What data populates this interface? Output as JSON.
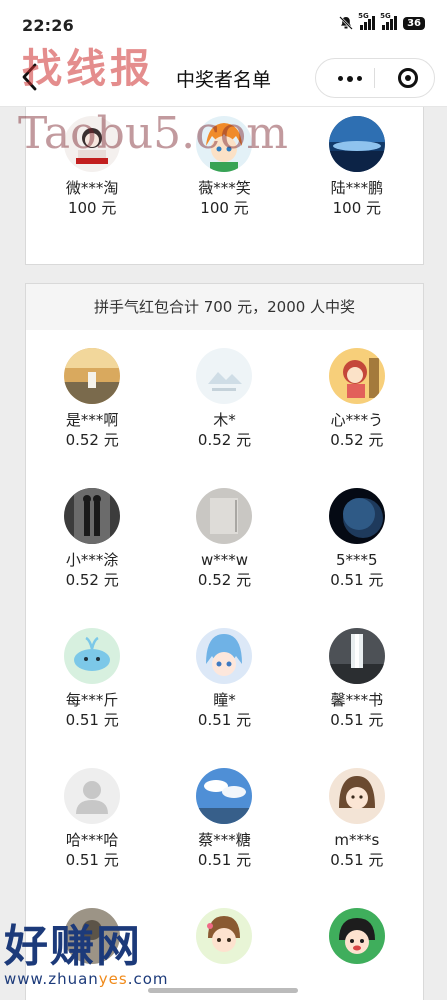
{
  "status_bar": {
    "time": "22:26",
    "network_1": "5G",
    "network_2": "5G",
    "battery": "36"
  },
  "nav": {
    "title": "中奖者名单"
  },
  "watermarks": {
    "top": "找线报",
    "mid": "Taobu5.com",
    "bottom_big": "好赚网",
    "bottom_small_a": "www.zhuan",
    "bottom_small_b": "yes",
    "bottom_small_c": ".com"
  },
  "prize_group_1": {
    "winners": [
      {
        "name": "微***淘",
        "amount": "100 元"
      },
      {
        "name": "薇***笑",
        "amount": "100 元"
      },
      {
        "name": "陆***鹏",
        "amount": "100 元"
      }
    ]
  },
  "prize_group_2": {
    "title": "拼手气红包合计 700 元，2000 人中奖",
    "winners": [
      {
        "name": "是***啊",
        "amount": "0.52 元"
      },
      {
        "name": "木*",
        "amount": "0.52 元"
      },
      {
        "name": "心***う",
        "amount": "0.52 元"
      },
      {
        "name": "小***涂",
        "amount": "0.52 元"
      },
      {
        "name": "w***w",
        "amount": "0.52 元"
      },
      {
        "name": "5***5",
        "amount": "0.51 元"
      },
      {
        "name": "每***斤",
        "amount": "0.51 元"
      },
      {
        "name": "瞳*",
        "amount": "0.51 元"
      },
      {
        "name": "馨***书",
        "amount": "0.51 元"
      },
      {
        "name": "哈***哈",
        "amount": "0.51 元"
      },
      {
        "name": "蔡***糖",
        "amount": "0.51 元"
      },
      {
        "name": "m***s",
        "amount": "0.51 元"
      },
      {
        "name": "",
        "amount": ""
      },
      {
        "name": "",
        "amount": ""
      },
      {
        "name": "",
        "amount": ""
      }
    ]
  },
  "colors": {
    "page_bg": "#ededed",
    "card_bg": "#ffffff",
    "header_bg": "#f5f5f5",
    "watermark_red": "#cd3030",
    "watermark_blue": "#1c3a7a"
  }
}
